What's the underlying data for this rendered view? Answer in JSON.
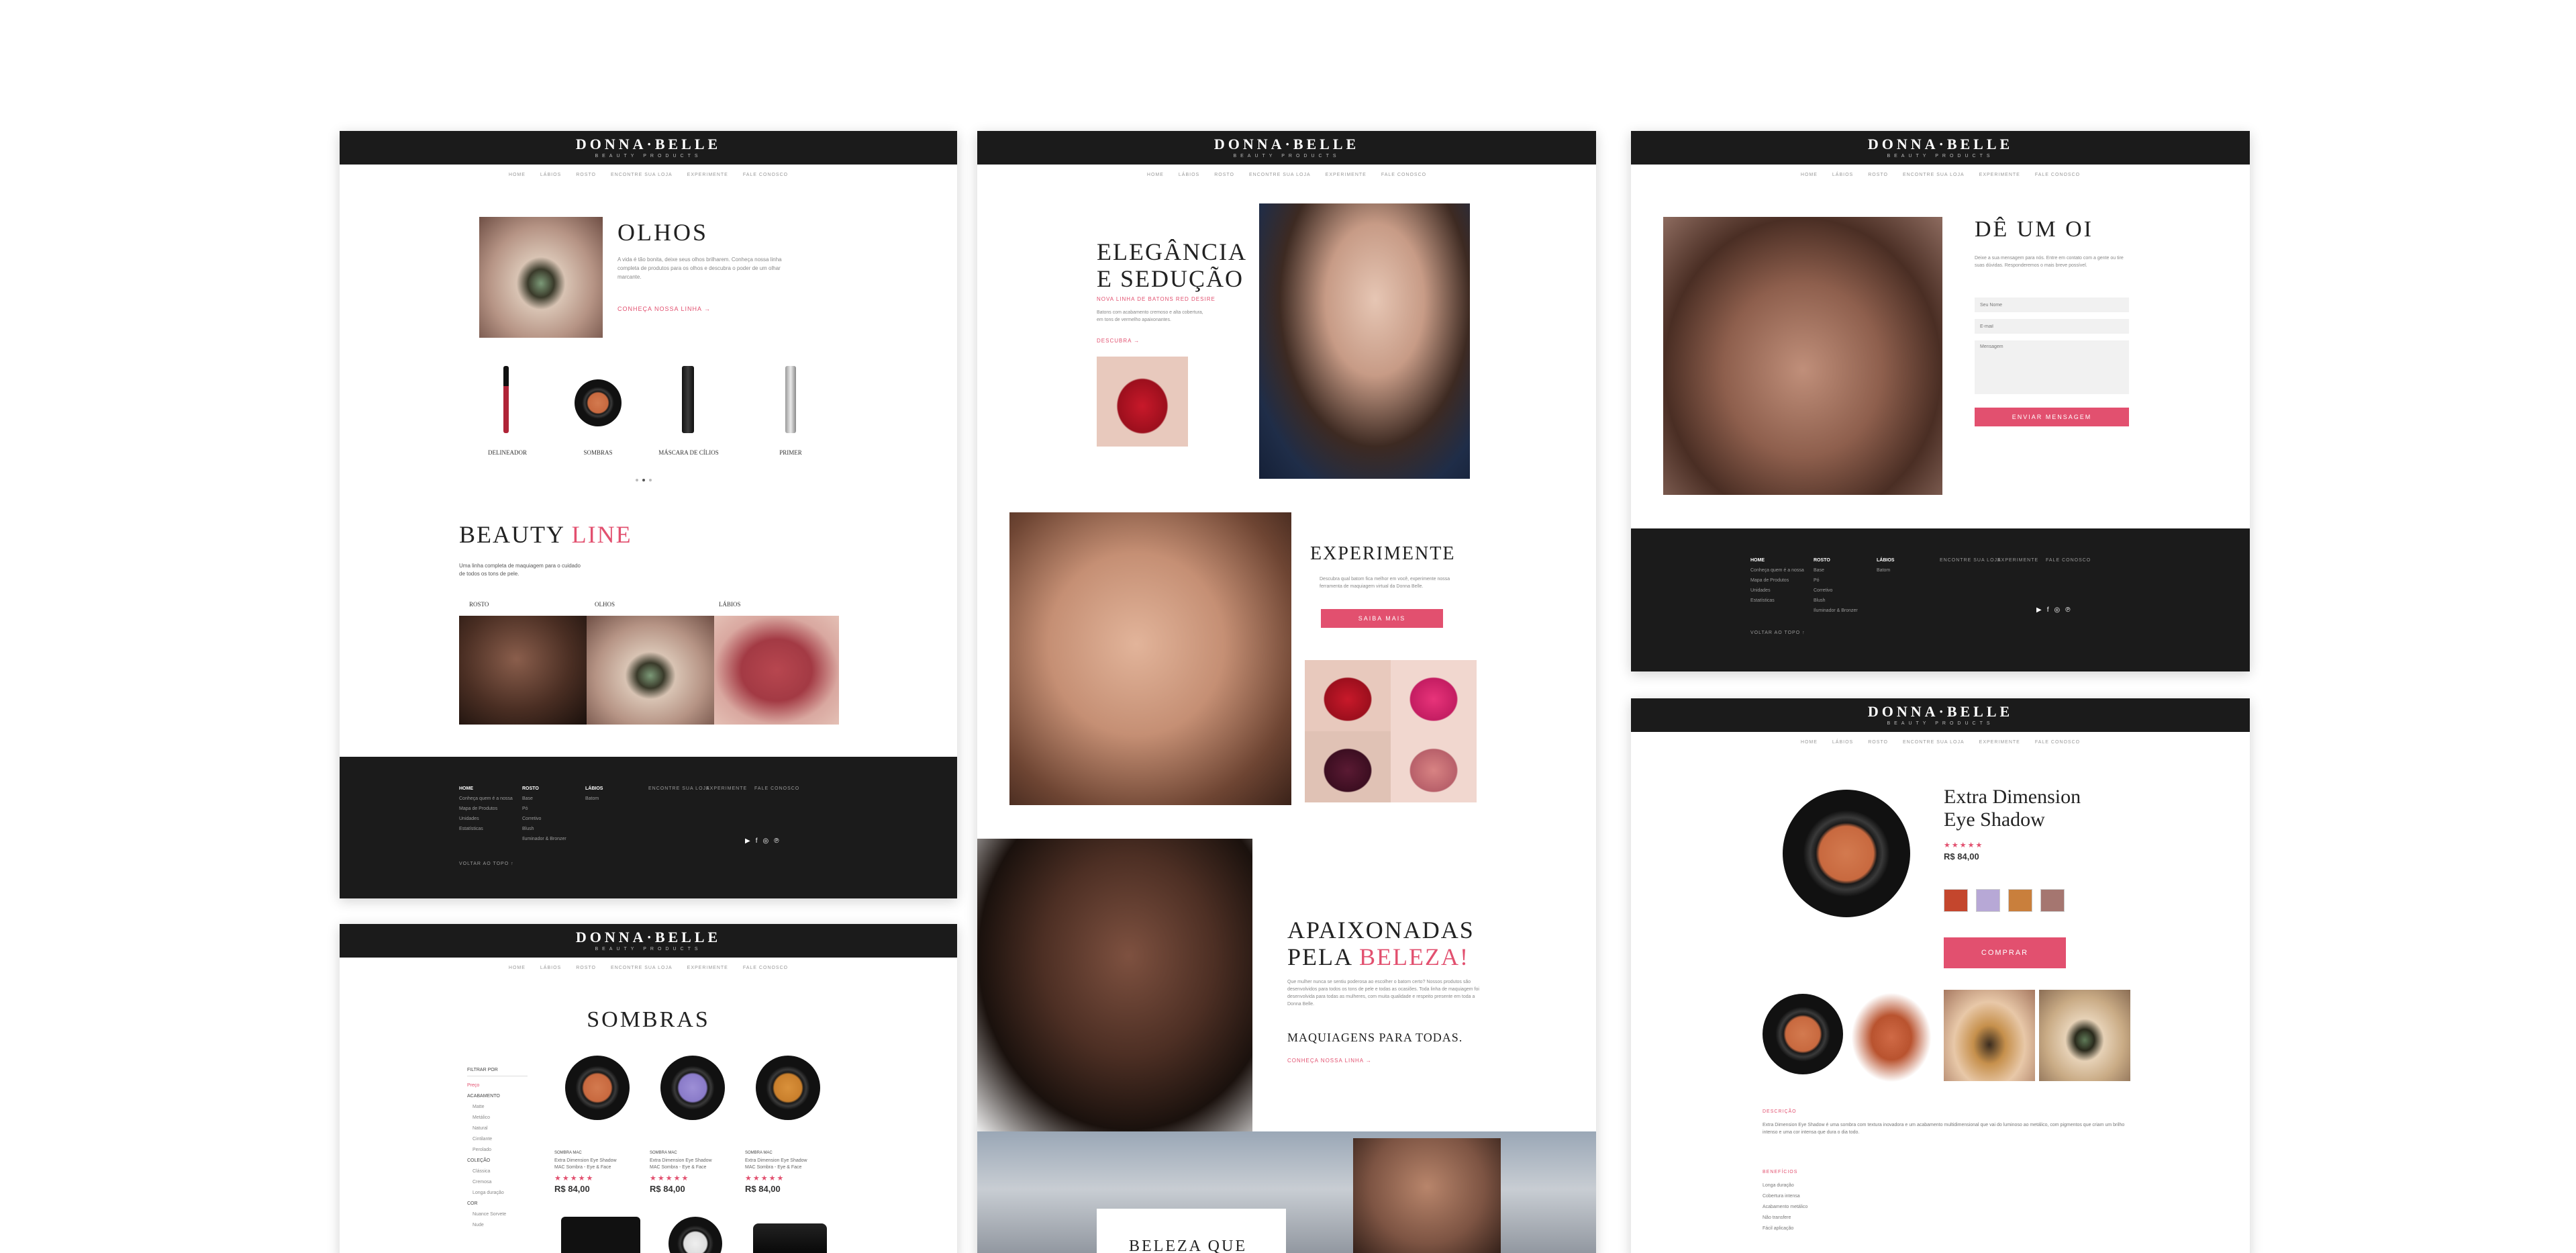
{
  "brand": {
    "logo": "DONNA·BELLE",
    "tagline": "BEAUTY PRODUCTS"
  },
  "nav": [
    "HOME",
    "LÁBIOS",
    "ROSTO",
    "ENCONTRE SUA LOJA",
    "EXPERIMENTE",
    "FALE CONOSCO"
  ],
  "colors": {
    "accent": "#e2506f",
    "dark": "#1b1b1b"
  },
  "page1": {
    "olhos": {
      "title": "OLHOS",
      "body": "A vida é tão bonita, deixe seus olhos brilharem. Conheça nossa linha completa de produtos para os olhos e descubra o poder de um olhar marcante.",
      "link": "CONHEÇA NOSSA LINHA  →"
    },
    "products": [
      {
        "label": "DELINEADOR"
      },
      {
        "label": "SOMBRAS"
      },
      {
        "label": "MÁSCARA DE CÍLIOS"
      },
      {
        "label": "PRIMER"
      }
    ],
    "beauty_line": {
      "title_a": "BEAUTY ",
      "title_b": "LINE",
      "body": "Uma linha completa de maquiagem para o cuidado de todos os tons de pele.",
      "cats": [
        "ROSTO",
        "OLHOS",
        "LÁBIOS"
      ]
    }
  },
  "footer": {
    "col1": [
      "HOME",
      "Conheça quem é a nossa",
      "Mapa de Produtos",
      "Unidades",
      "Estatísticas"
    ],
    "col2": [
      "ROSTO",
      "Base",
      "Pó",
      "Corretivo",
      "Blush",
      "Iluminador & Bronzer"
    ],
    "col3": [
      "LÁBIOS",
      "Batom"
    ],
    "links": [
      "ENCONTRE SUA LOJA",
      "EXPERIMENTE",
      "FALE CONOSCO"
    ],
    "back": "VOLTAR AO TOPO  ↑"
  },
  "page2": {
    "title": "ELEGÂNCIA\nE SEDUÇÃO",
    "subtitle": "NOVA LINHA DE BATONS RED DESIRE",
    "body": "Batons com acabamento cremoso e alta cobertura, em tons de vermelho apaixonantes.",
    "link": "DESCUBRA  →",
    "experimente": {
      "title": "EXPERIMENTE",
      "body": "Descubra qual batom fica melhor em você, experimente nossa ferramenta de maquiagem virtual da Donna Belle.",
      "button": "SAIBA MAIS"
    },
    "apaixonadas": {
      "title_a": "APAIXONADAS\nPELA ",
      "title_b": "BELEZA!",
      "body": "Que mulher nunca se sentiu poderosa ao escolher o batom certo? Nossos produtos são desenvolvidos para todos os tons de pele e todas as ocasiões. Toda linha de maquiagem foi desenvolvida para todas as mulheres, com muita qualidade e respeito presente em toda a Donna Belle.",
      "sub": "MAQUIAGENS PARA TODAS.",
      "link": "CONHEÇA NOSSA LINHA  →"
    },
    "banner": "BELEZA QUE"
  },
  "page3": {
    "title": "DÊ UM OI",
    "body": "Deixe a sua mensagem para nós. Entre em contato com a gente ou tire suas dúvidas. Responderemos o mais breve possível.",
    "placeholder_name": "Seu Nome",
    "placeholder_email": "E-mail",
    "placeholder_msg": "Mensagem",
    "button": "ENVIAR MENSAGEM"
  },
  "page4": {
    "title": "Extra Dimension\nEye Shadow",
    "stars": "★★★★★",
    "price": "R$ 84,00",
    "swatches": [
      "#c4462d",
      "#b7a8d6",
      "#c97f3c",
      "#a57670"
    ],
    "button": "COMPRAR",
    "desc_head": "DESCRIÇÃO",
    "desc": "Extra Dimension Eye Shadow é uma sombra com textura inovadora e um acabamento multidimensional que vai do luminoso ao metálico, com pigmentos que criam um brilho intenso e uma cor intensa que dura o dia todo.",
    "feat_head": "BENEFÍCIOS",
    "feats": [
      "Longa duração",
      "Cobertura intensa",
      "Acabamento metálico",
      "Não transfere",
      "Fácil aplicação"
    ]
  },
  "page5": {
    "title": "SOMBRAS",
    "filter_head": "FILTRAR POR",
    "filters": [
      "Preço",
      "ACABAMENTO",
      "Matte",
      "Metálico",
      "Natural",
      "Cintilante",
      "Perolado",
      "COLEÇÃO",
      "Clássica",
      "Cremosa",
      "Longa duração",
      "COR",
      "Nuance Sorvete",
      "Nude"
    ],
    "products": [
      {
        "tag": "SOMBRA MAC",
        "name": "Extra Dimension Eye Shadow MAC Sombra - Eye & Face",
        "stars": "★★★★★",
        "price": "R$ 84,00"
      },
      {
        "tag": "SOMBRA MAC",
        "name": "Extra Dimension Eye Shadow MAC Sombra - Eye & Face",
        "stars": "★★★★★",
        "price": "R$ 84,00"
      },
      {
        "tag": "SOMBRA MAC",
        "name": "Extra Dimension Eye Shadow MAC Sombra - Eye & Face",
        "stars": "★★★★★",
        "price": "R$ 84,00"
      }
    ]
  }
}
